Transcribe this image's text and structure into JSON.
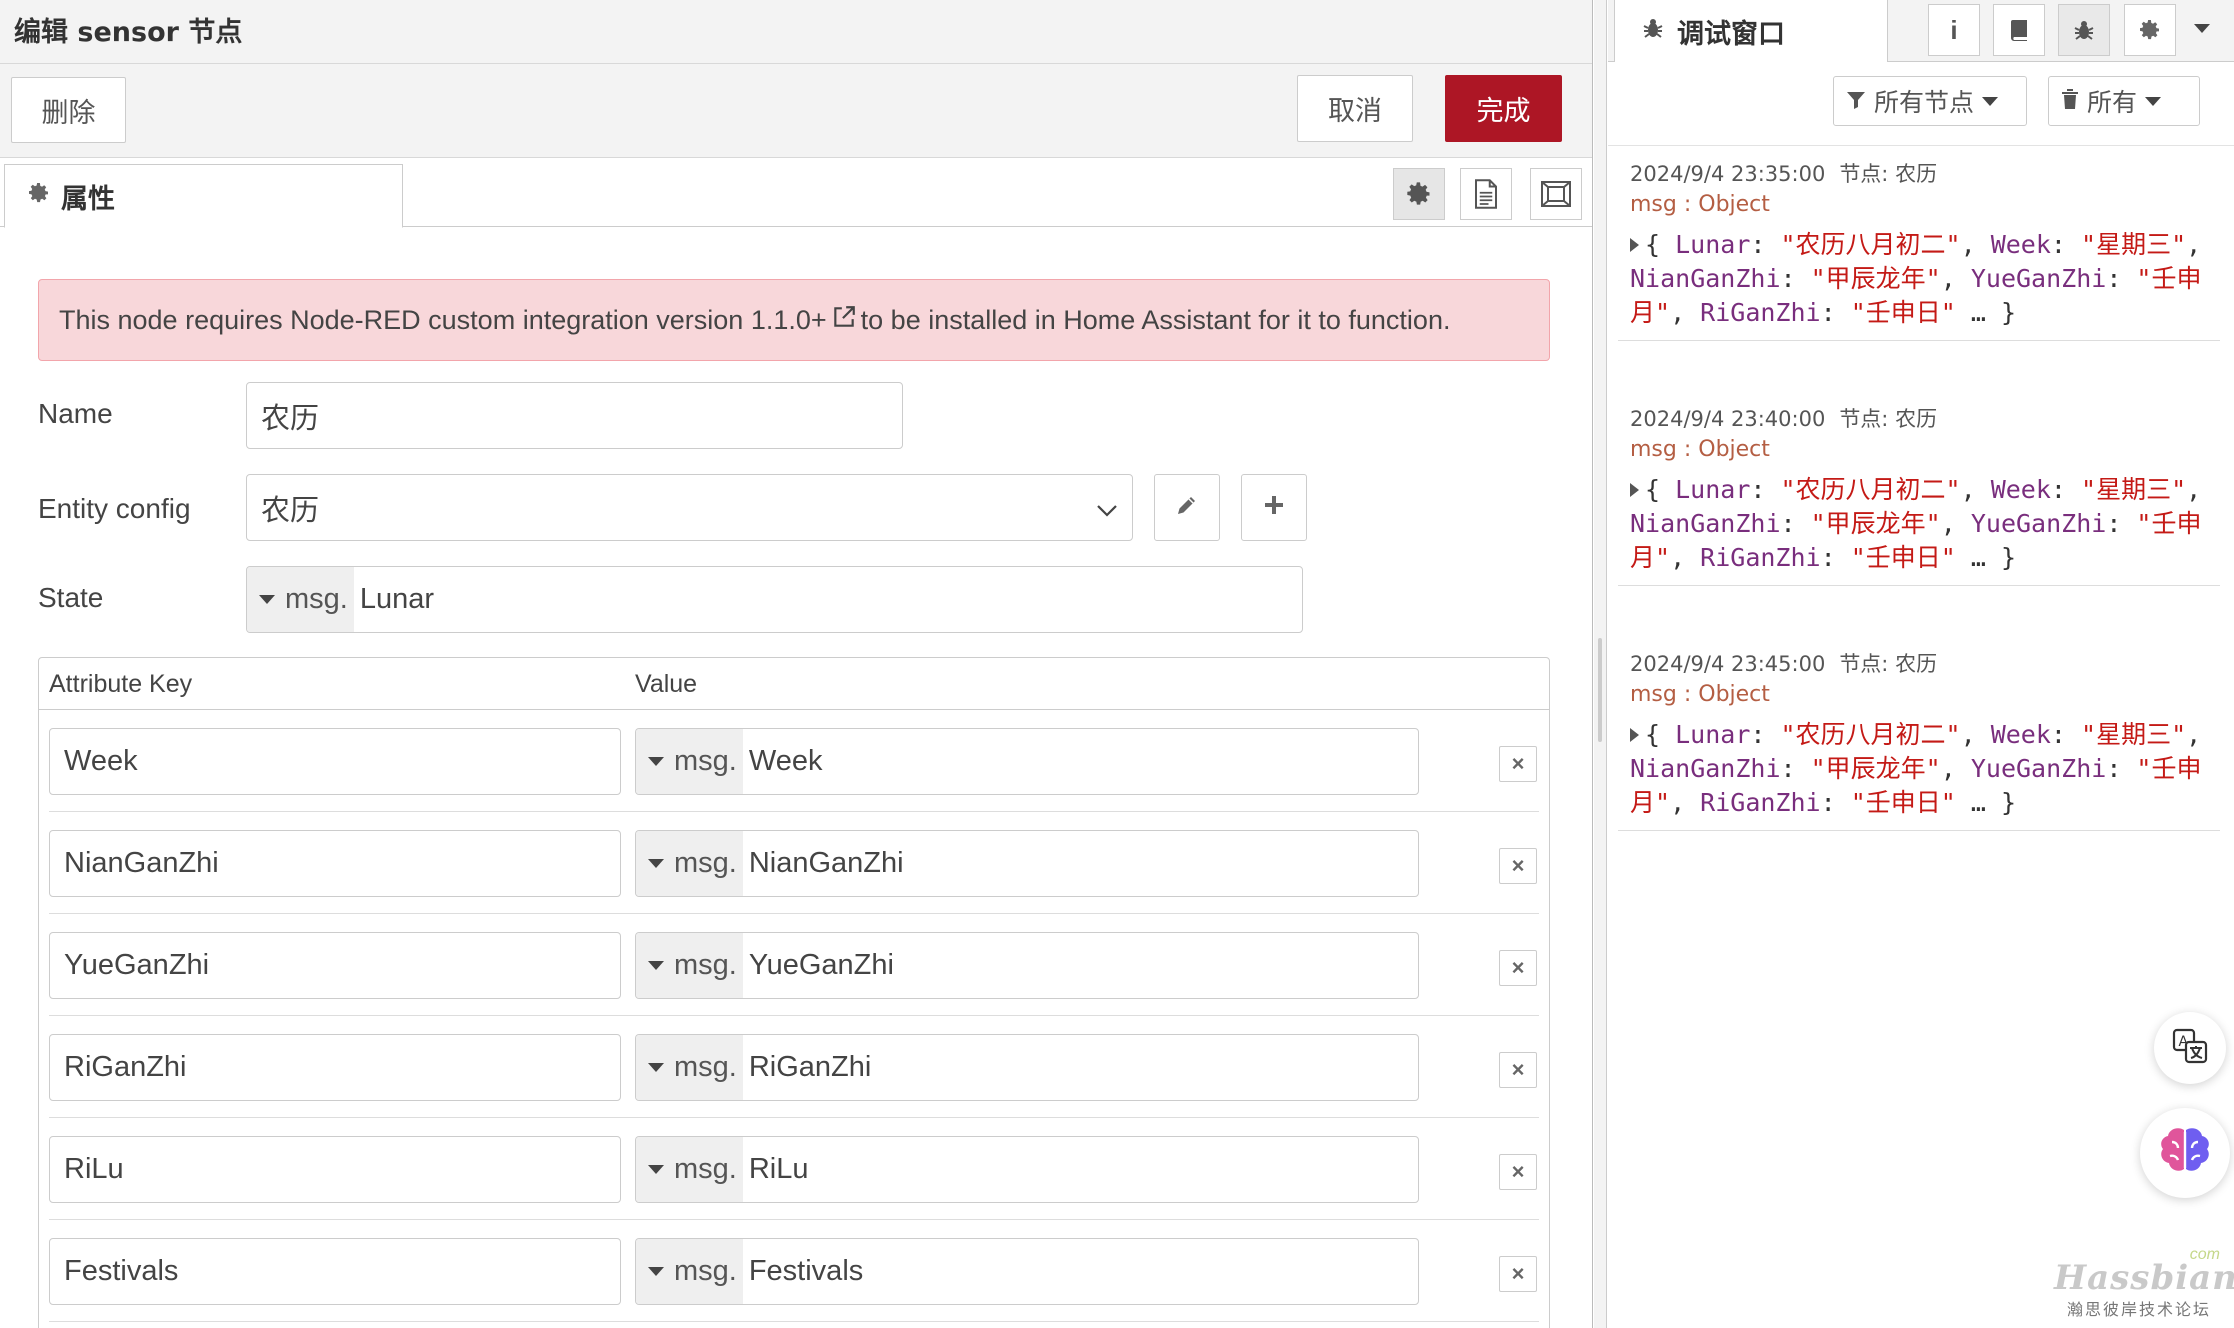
{
  "editor": {
    "title": "编辑 sensor 节点",
    "buttons": {
      "delete": "删除",
      "cancel": "取消",
      "done": "完成"
    },
    "tab_label": "属性",
    "warning": {
      "before": "This node requires Node-RED custom integration version 1.1.0+",
      "after": "to be installed in Home Assistant for it to function."
    },
    "fields": {
      "name_label": "Name",
      "name_value": "农历",
      "entity_label": "Entity config",
      "entity_value": "农历",
      "state_label": "State",
      "state_type": "msg.",
      "state_value": "Lunar"
    },
    "attributes": {
      "key_header": "Attribute Key",
      "value_header": "Value",
      "rows": [
        {
          "key": "Week",
          "type": "msg.",
          "value": "Week"
        },
        {
          "key": "NianGanZhi",
          "type": "msg.",
          "value": "NianGanZhi"
        },
        {
          "key": "YueGanZhi",
          "type": "msg.",
          "value": "YueGanZhi"
        },
        {
          "key": "RiGanZhi",
          "type": "msg.",
          "value": "RiGanZhi"
        },
        {
          "key": "RiLu",
          "type": "msg.",
          "value": "RiLu"
        },
        {
          "key": "Festivals",
          "type": "msg.",
          "value": "Festivals"
        }
      ]
    },
    "colors": {
      "done_button": "#ad1625",
      "warning_bg": "#f8d7da"
    }
  },
  "sidebar": {
    "title": "调试窗口",
    "tab_icons": [
      "info-icon",
      "book-icon",
      "bug-icon",
      "gear-icon"
    ],
    "filters": {
      "nodes": "所有节点",
      "all": "所有"
    },
    "messages": [
      {
        "time": "2024/9/4 23:35:00",
        "node": "节点: 农历",
        "type": "msg : Object",
        "body": {
          "open": "{ ",
          "k1": "Lunar",
          "v1": "\"农历八月初二\"",
          "k2": "Week",
          "v2": "\"星期三\"",
          "k3": "NianGanZhi",
          "v3": "\"甲辰龙年\"",
          "k4": "YueGanZhi",
          "v4": "\"壬申月\"",
          "k5": "RiGanZhi",
          "v5": "\"壬申日\"",
          "close": " … }"
        }
      },
      {
        "time": "2024/9/4 23:40:00",
        "node": "节点: 农历",
        "type": "msg : Object",
        "body": {
          "open": "{ ",
          "k1": "Lunar",
          "v1": "\"农历八月初二\"",
          "k2": "Week",
          "v2": "\"星期三\"",
          "k3": "NianGanZhi",
          "v3": "\"甲辰龙年\"",
          "k4": "YueGanZhi",
          "v4": "\"壬申月\"",
          "k5": "RiGanZhi",
          "v5": "\"壬申日\"",
          "close": " … }"
        }
      },
      {
        "time": "2024/9/4 23:45:00",
        "node": "节点: 农历",
        "type": "msg : Object",
        "body": {
          "open": "{ ",
          "k1": "Lunar",
          "v1": "\"农历八月初二\"",
          "k2": "Week",
          "v2": "\"星期三\"",
          "k3": "NianGanZhi",
          "v3": "\"甲辰龙年\"",
          "k4": "YueGanZhi",
          "v4": "\"壬申月\"",
          "k5": "RiGanZhi",
          "v5": "\"壬申日\"",
          "close": " … }"
        }
      }
    ]
  },
  "watermark": {
    "brand": "Hassbian",
    "com": "com",
    "subtitle": "瀚思彼岸技术论坛"
  }
}
